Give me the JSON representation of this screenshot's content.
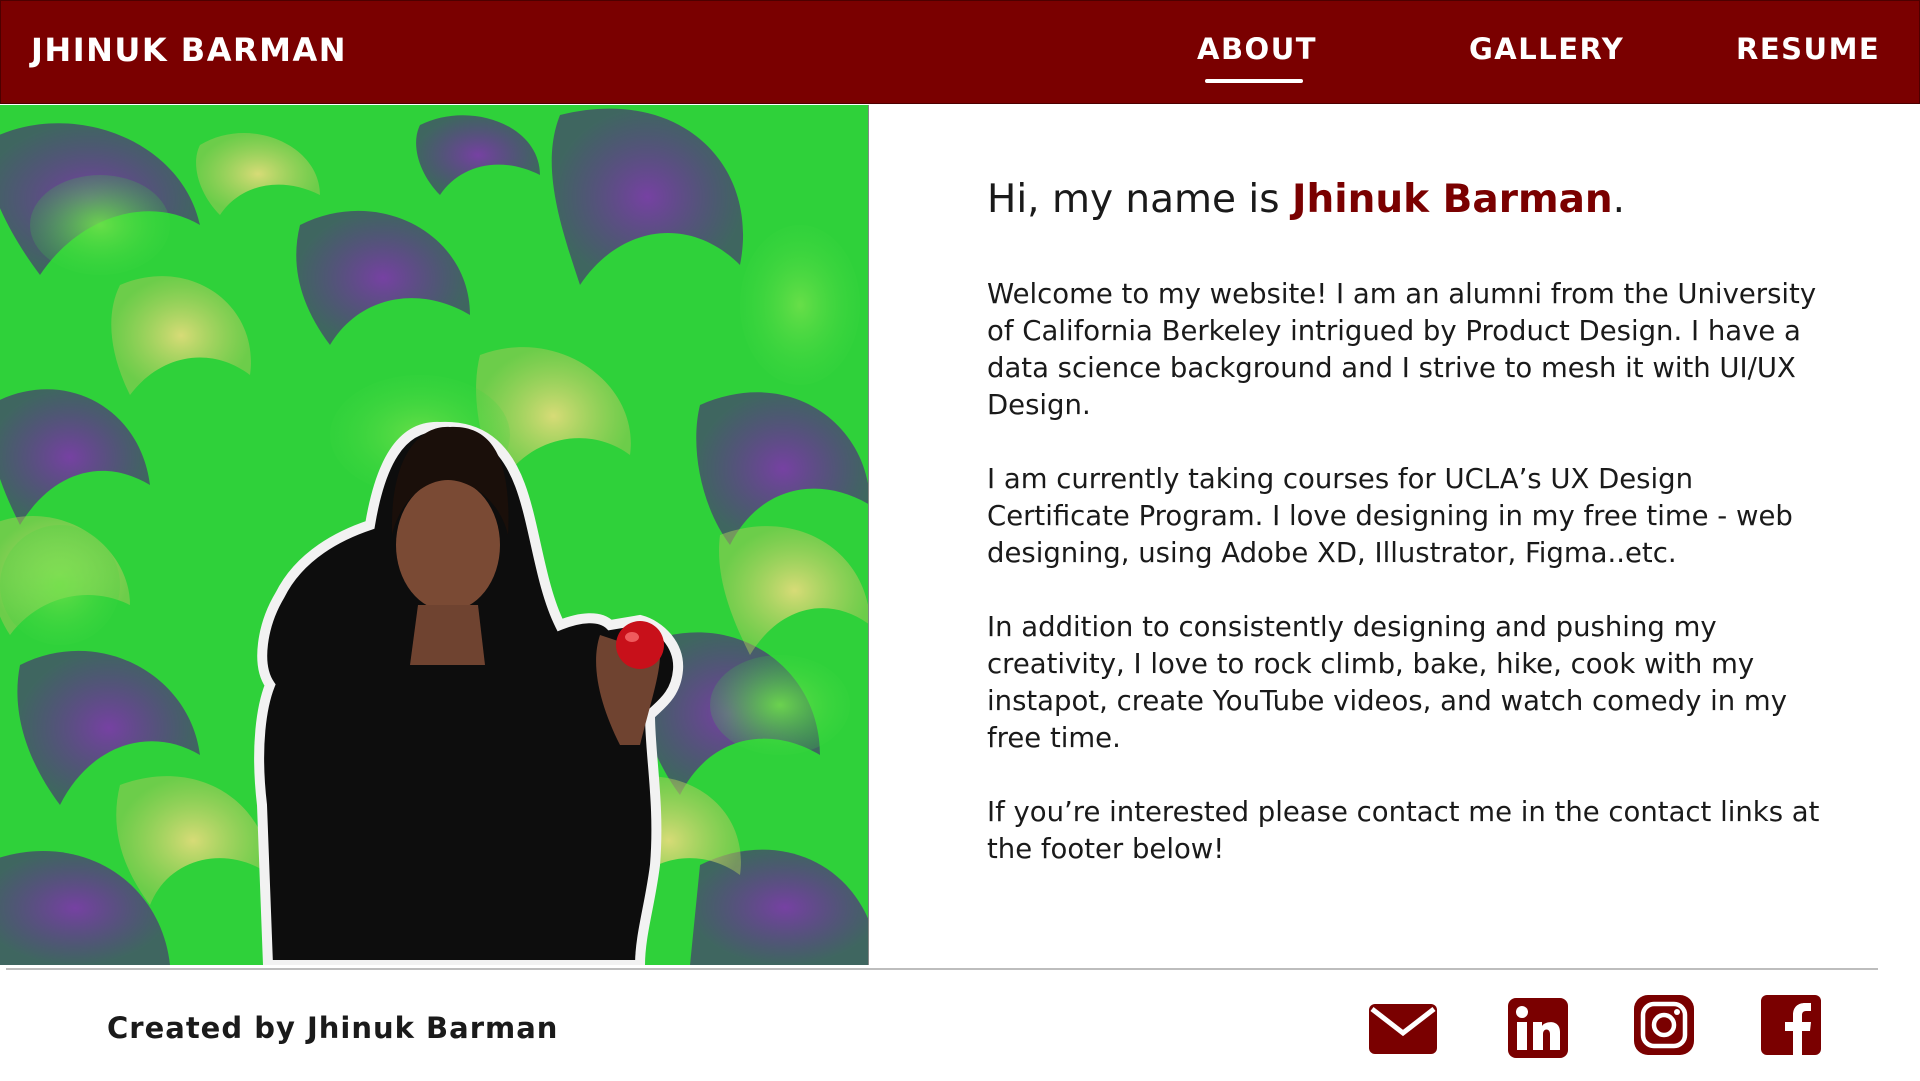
{
  "header": {
    "brand": "JHINUK BARMAN",
    "nav": {
      "about": "ABOUT",
      "gallery": "GALLERY",
      "resume": "RESUME"
    },
    "active_tab": "ABOUT"
  },
  "intro": {
    "greeting_prefix": "Hi, my name is ",
    "greeting_name": "Jhinuk Barman",
    "greeting_suffix": ".",
    "paragraphs": [
      "Welcome to my website! I am an alumni from the University of California Berkeley intrigued by Product Design. I have a data science background and I strive to mesh it with UI/UX Design.",
      "I am currently taking courses for UCLA’s UX Design Certificate Program. I love designing in my free time - web designing, using Adobe XD, Illustrator, Figma..etc.",
      "In addition to consistently designing and pushing my creativity, I love to rock climb, bake, hike, cook with my instapot, create YouTube videos, and watch comedy in my free time.",
      "If you’re interested please contact me in the contact links at the footer below!"
    ]
  },
  "footer": {
    "credit": "Created by Jhinuk Barman",
    "social_icons": [
      "mail-icon",
      "linkedin-icon",
      "instagram-icon",
      "facebook-icon"
    ]
  },
  "colors": {
    "brand": "#7a0000",
    "art_green": "#2fd13a",
    "art_purple": "#5a2a8a",
    "art_yellow": "#c9d46a"
  }
}
